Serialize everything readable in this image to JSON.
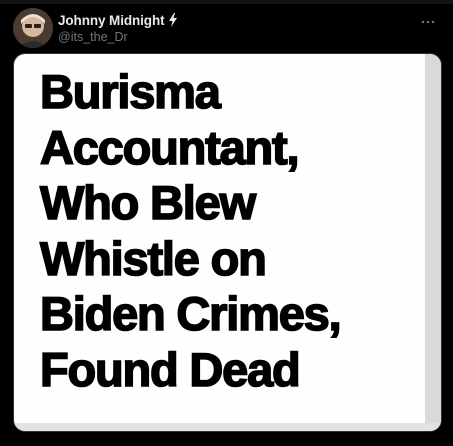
{
  "post": {
    "author": {
      "display_name": "Johnny Midnight",
      "handle": "@its_the_Dr",
      "badge_icon": "lightning-bolt-icon",
      "badge_color": "#e7e9ea"
    },
    "more_icon": "ellipsis-icon",
    "media": {
      "headline_lines": [
        "Burisma",
        "Accountant,",
        "Who Blew",
        "Whistle on",
        "Biden Crimes,",
        "Found Dead"
      ]
    }
  },
  "colors": {
    "background": "#000000",
    "primary_text": "#e7e9ea",
    "secondary_text": "#71767b",
    "image_background": "#fefefe",
    "headline_text": "#000000"
  }
}
